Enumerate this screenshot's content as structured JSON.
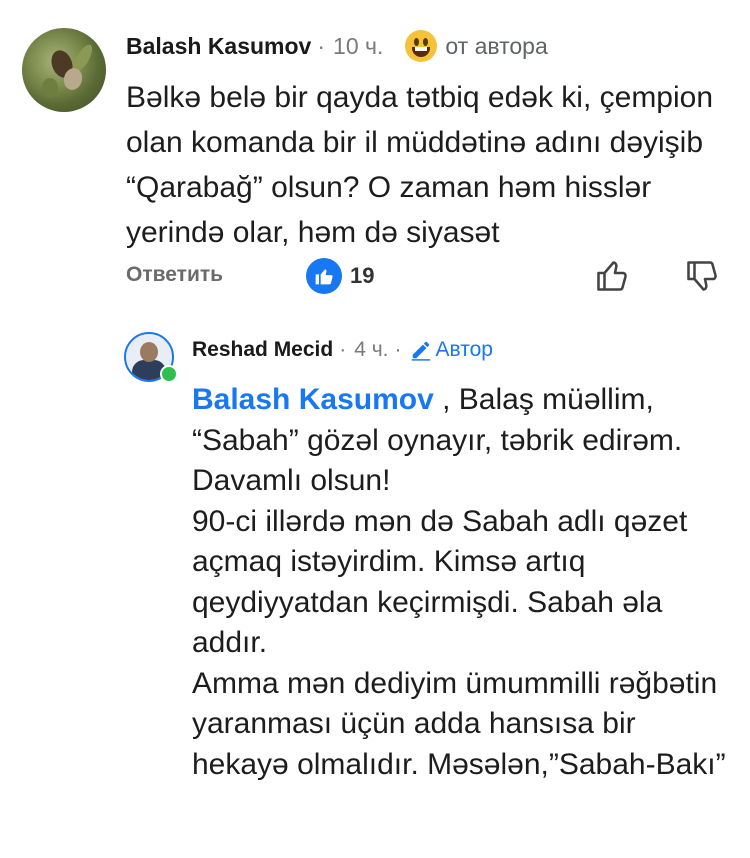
{
  "comment": {
    "author": "Balash Kasumov",
    "separator": "·",
    "time": "10 ч.",
    "emoji_icon": "grinning-face-icon",
    "author_note": "от автора",
    "text": "Bəlkə belə bir qayda tətbiq edək ki, çempion olan komanda bir il müddətinə adını dəyişib “Qarabağ” olsun? O zaman həm hisslər yerində olar, həm də siyasət",
    "reply_label": "Ответить",
    "like_count": "19"
  },
  "reply": {
    "author": "Reshad Mecid",
    "separator": "·",
    "time": "4 ч.",
    "separator2": "·",
    "badge": "Автор",
    "mention": "Balash Kasumov",
    "text_lines": [
      " , Balaş müəllim, “Sabah” gözəl oynayır, təbrik edirəm. Davamlı olsun!",
      "90-ci illərdə  mən də Sabah adlı qəzet açmaq istəyirdim. Kimsə artıq qeydiyyatdan keçirmişdi. Sabah əla addır.",
      "Amma mən dediyim ümummilli rəğbətin yaranması üçün adda hansısa bir hekayə olmalıdır. Məsələn,”Sabah-Bakı”"
    ]
  },
  "colors": {
    "accent": "#1877f2",
    "online": "#2fbf4f",
    "muted": "#7a7a7a"
  }
}
